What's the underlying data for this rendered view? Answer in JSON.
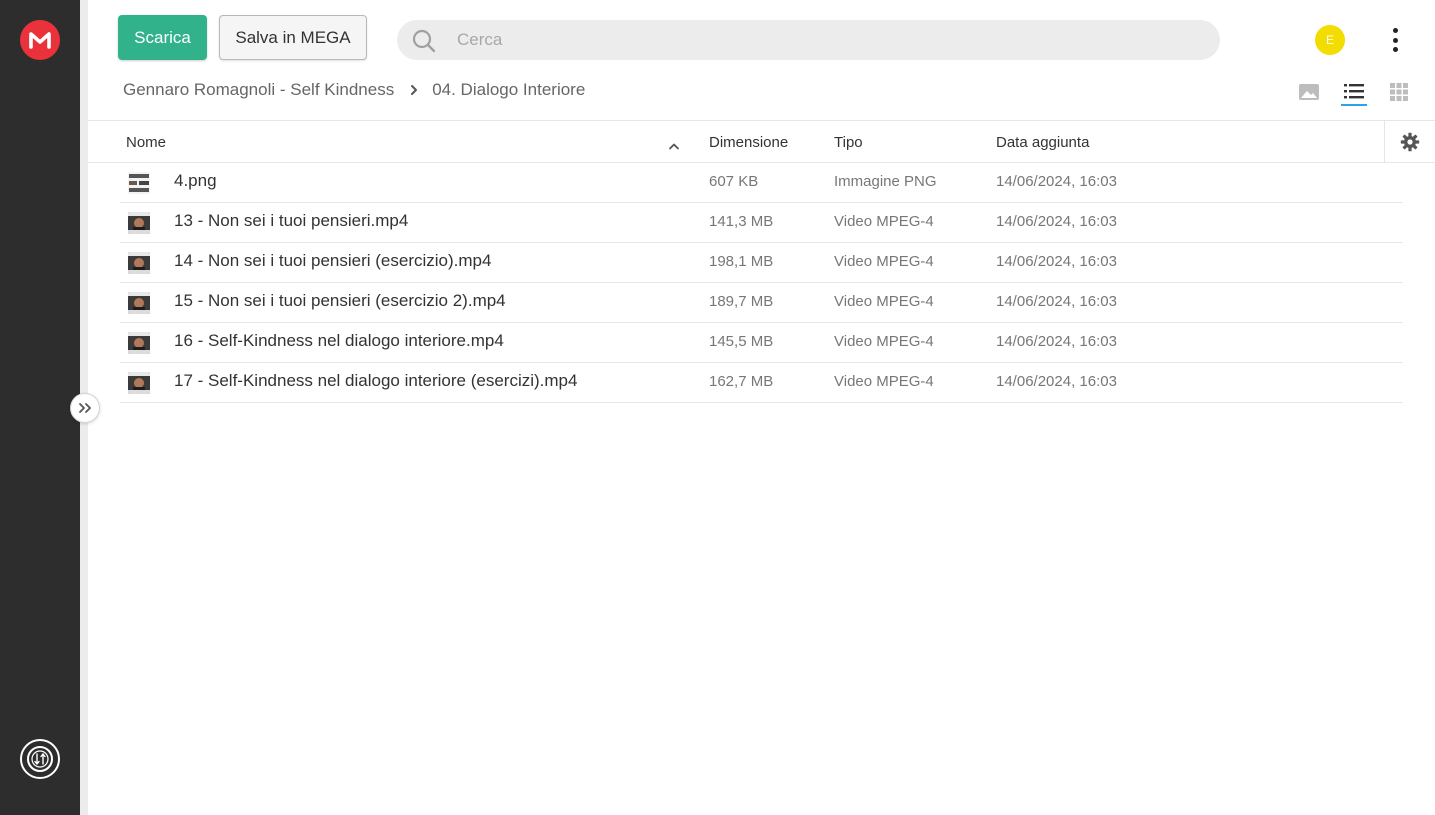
{
  "header": {
    "download_label": "Scarica",
    "save_label": "Salva in MEGA",
    "search_placeholder": "Cerca",
    "avatar_initial": "E"
  },
  "breadcrumb": {
    "items": [
      "Gennaro Romagnoli - Self Kindness",
      "04. Dialogo Interiore"
    ]
  },
  "table": {
    "columns": {
      "name": "Nome",
      "size": "Dimensione",
      "type": "Tipo",
      "date": "Data aggiunta"
    },
    "rows": [
      {
        "name": "4.png",
        "size": "607 KB",
        "type": "Immagine PNG",
        "date": "14/06/2024, 16:03",
        "thumb": "image"
      },
      {
        "name": "13 - Non sei i tuoi pensieri.mp4",
        "size": "141,3 MB",
        "type": "Video MPEG-4",
        "date": "14/06/2024, 16:03",
        "thumb": "video"
      },
      {
        "name": "14 - Non sei i tuoi pensieri (esercizio).mp4",
        "size": "198,1 MB",
        "type": "Video MPEG-4",
        "date": "14/06/2024, 16:03",
        "thumb": "video"
      },
      {
        "name": "15 - Non sei i tuoi pensieri (esercizio 2).mp4",
        "size": "189,7 MB",
        "type": "Video MPEG-4",
        "date": "14/06/2024, 16:03",
        "thumb": "video"
      },
      {
        "name": "16 - Self-Kindness nel dialogo interiore.mp4",
        "size": "145,5 MB",
        "type": "Video MPEG-4",
        "date": "14/06/2024, 16:03",
        "thumb": "video"
      },
      {
        "name": "17 - Self-Kindness nel dialogo interiore (esercizi).mp4",
        "size": "162,7 MB",
        "type": "Video MPEG-4",
        "date": "14/06/2024, 16:03",
        "thumb": "video"
      }
    ]
  },
  "colors": {
    "brand": "#e9323b",
    "download_button": "#31b28b",
    "avatar": "#f3dc00",
    "active_view": "#2ea4e6",
    "rail": "#2d2d2d"
  },
  "icons": {
    "logo": "mega-logo-icon",
    "search": "search-icon",
    "menu": "kebab-menu-icon",
    "sort": "sort-ascending-icon",
    "settings": "gear-icon",
    "transfers": "transfers-icon",
    "expand": "expand-sidebar-icon",
    "views": [
      "gallery-view-icon",
      "list-view-icon",
      "grid-view-icon"
    ]
  },
  "view": {
    "active": "list"
  }
}
